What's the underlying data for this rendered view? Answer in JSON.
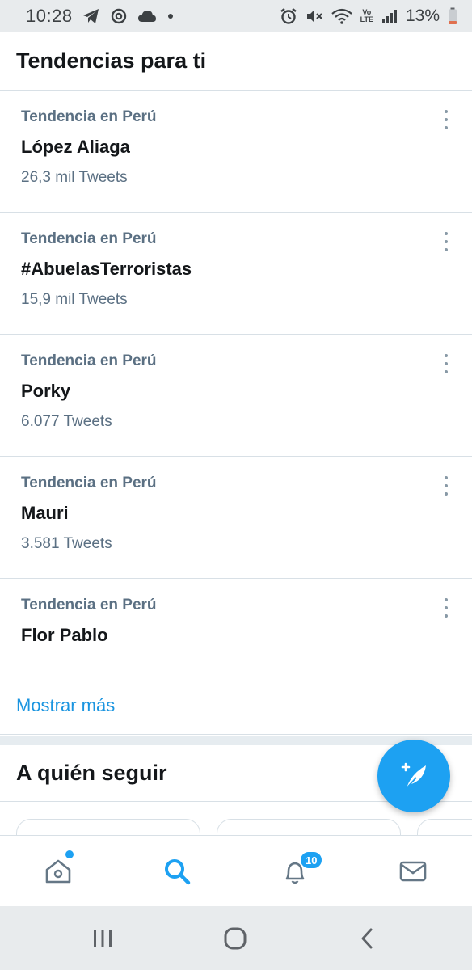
{
  "status_bar": {
    "time": "10:28",
    "battery": "13%",
    "volte_label_top": "Vo",
    "volte_label_bottom": "LTE",
    "left_icons": [
      "telegram-icon",
      "sync-icon",
      "cloud-icon",
      "dot-icon"
    ],
    "right_icons": [
      "alarm-icon",
      "mute-icon",
      "wifi-icon",
      "volte-icon",
      "signal-icon",
      "battery-icon"
    ]
  },
  "header": {
    "title": "Tendencias para ti"
  },
  "trends": [
    {
      "context": "Tendencia en Perú",
      "title": "López Aliaga",
      "count": "26,3 mil Tweets"
    },
    {
      "context": "Tendencia en Perú",
      "title": "#AbuelasTerroristas",
      "count": "15,9 mil Tweets"
    },
    {
      "context": "Tendencia en Perú",
      "title": "Porky",
      "count": "6.077 Tweets"
    },
    {
      "context": "Tendencia en Perú",
      "title": "Mauri",
      "count": "3.581 Tweets"
    },
    {
      "context": "Tendencia en Perú",
      "title": "Flor Pablo",
      "count": ""
    }
  ],
  "show_more": "Mostrar más",
  "who_to_follow": {
    "title": "A quién seguir"
  },
  "fab": {
    "icon": "compose-tweet-icon"
  },
  "bottom_nav": {
    "items": [
      {
        "name": "home",
        "icon": "home-icon",
        "active": false,
        "has_dot": true
      },
      {
        "name": "search",
        "icon": "search-icon",
        "active": true
      },
      {
        "name": "notifications",
        "icon": "bell-icon",
        "active": false,
        "badge": "10"
      },
      {
        "name": "messages",
        "icon": "mail-icon",
        "active": false
      }
    ]
  },
  "system_nav": {
    "icons": [
      "recent-apps-icon",
      "home-circle-icon",
      "back-icon"
    ]
  },
  "colors": {
    "accent": "#1da1f2",
    "link": "#1b95e0",
    "secondary_text": "#5b7083",
    "primary_text": "#14171a",
    "divider": "#d8e0e6"
  }
}
